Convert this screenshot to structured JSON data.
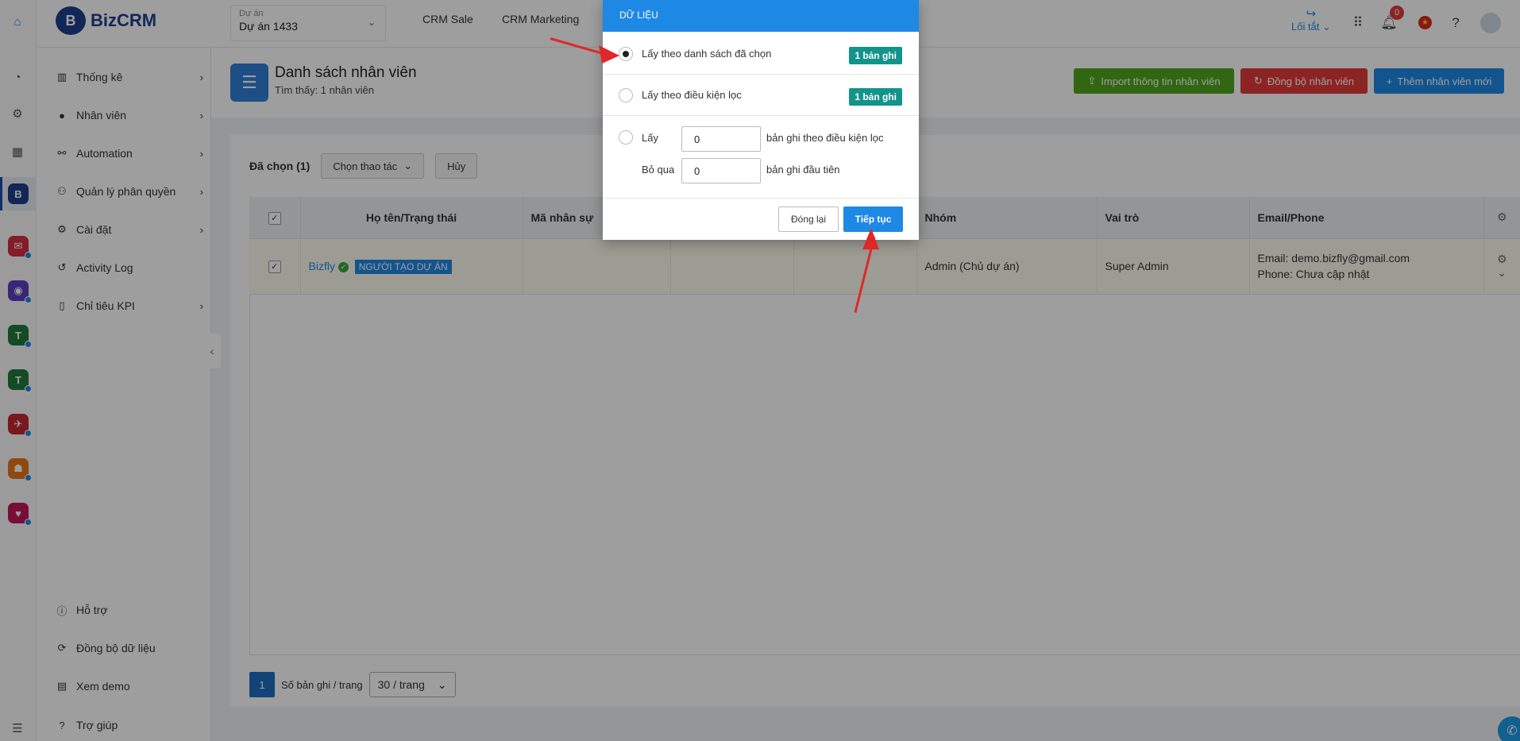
{
  "header": {
    "logo_text": "BizCRM",
    "project_label": "Dự án",
    "project_value": "Dự án 1433",
    "nav": [
      "CRM Sale",
      "CRM Marketing"
    ],
    "share_label": "Lối tắt",
    "notification_count": "0"
  },
  "sidebar": {
    "items": [
      {
        "label": "Thống kê",
        "icon": "chart-icon"
      },
      {
        "label": "Nhân viên",
        "icon": "user-icon"
      },
      {
        "label": "Automation",
        "icon": "automation-icon"
      },
      {
        "label": "Quản lý phân quyền",
        "icon": "permission-icon"
      },
      {
        "label": "Cài đặt",
        "icon": "gear-icon"
      },
      {
        "label": "Activity Log",
        "icon": "history-icon"
      },
      {
        "label": "Chỉ tiêu KPI",
        "icon": "kpi-icon"
      }
    ],
    "bottom": [
      {
        "label": "Hỗ trợ",
        "icon": "info-icon"
      },
      {
        "label": "Đồng bộ dữ liệu",
        "icon": "sync-icon"
      },
      {
        "label": "Xem demo",
        "icon": "demo-icon"
      },
      {
        "label": "Trợ giúp",
        "icon": "help-icon"
      }
    ]
  },
  "page": {
    "title": "Danh sách nhân viên",
    "subtitle": "Tìm thấy: 1 nhân viên",
    "import_label": "Import thông tin nhân viên",
    "sync_label": "Đồng bộ nhân viên",
    "add_label": "Thêm nhân viên mới"
  },
  "selection": {
    "selected_label": "Đã chọn (1)",
    "action_label": "Chọn thao tác",
    "cancel_label": "Hủy"
  },
  "table": {
    "columns": [
      "Họ tên/Trạng thái",
      "Mã nhân sự",
      "",
      "",
      "Nhóm",
      "Vai trò",
      "Email/Phone"
    ],
    "row": {
      "name": "Bizfly",
      "tag": "NGƯỜI TẠO DỰ ÁN",
      "group": "Admin (Chủ dự án)",
      "role": "Super Admin",
      "email": "Email: demo.bizfly@gmail.com",
      "phone": "Phone: Chưa cập nhật"
    }
  },
  "pagination": {
    "page": "1",
    "per_page_label": "Số bản ghi / trang",
    "per_page_value": "30 / trang"
  },
  "modal": {
    "title": "DỮ LIỆU",
    "option1_label": "Lấy theo danh sách đã chọn",
    "option1_badge": "1 bản ghi",
    "option2_label": "Lấy theo điều kiện lọc",
    "option2_badge": "1 bản ghi",
    "option3_take": "Lấy",
    "option3_take_value": "0",
    "option3_take_suffix": "bản ghi theo điều kiện lọc",
    "option3_skip": "Bỏ qua",
    "option3_skip_value": "0",
    "option3_skip_suffix": "bản ghi đầu tiên",
    "close_label": "Đóng lại",
    "continue_label": "Tiếp tục"
  },
  "colors": {
    "primary": "#1e88e5",
    "import_btn": "#52a51e",
    "sync_btn": "#e33b3b",
    "badge": "#13948a",
    "annotation_arrow": "#e02828"
  }
}
